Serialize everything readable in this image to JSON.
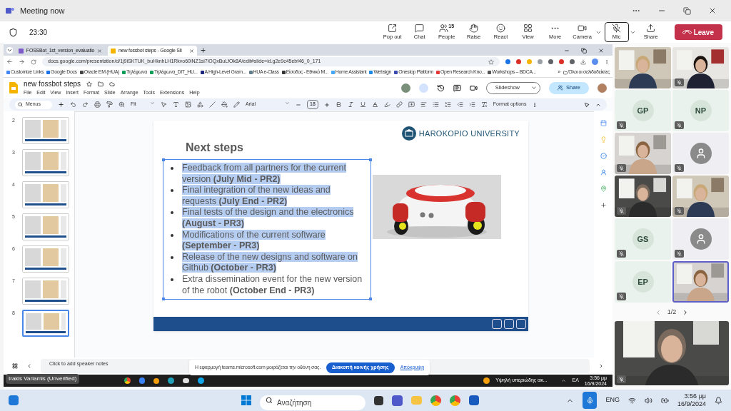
{
  "window": {
    "title": "Meeting now"
  },
  "meeting_bar": {
    "timer": "23:30",
    "actions": [
      {
        "kind": "popout",
        "label": "Pop out",
        "selected": false,
        "dropdown": false
      },
      {
        "kind": "chat",
        "label": "Chat",
        "selected": false,
        "dropdown": false
      },
      {
        "kind": "people",
        "label": "People",
        "count": "15",
        "selected": false,
        "dropdown": false
      },
      {
        "kind": "raise",
        "label": "Raise",
        "selected": false,
        "dropdown": false
      },
      {
        "kind": "react",
        "label": "React",
        "selected": false,
        "dropdown": false
      },
      {
        "kind": "view",
        "label": "View",
        "selected": false,
        "dropdown": false
      },
      {
        "kind": "more",
        "label": "More",
        "selected": false,
        "dropdown": false
      },
      {
        "kind": "camera",
        "label": "Camera",
        "selected": false,
        "dropdown": true
      },
      {
        "kind": "mic",
        "label": "Mic",
        "selected": true,
        "dropdown": true
      },
      {
        "kind": "share",
        "label": "Share",
        "selected": false,
        "dropdown": false
      }
    ],
    "leave_button": "Leave"
  },
  "shared_screen": {
    "browser": {
      "tabs": [
        {
          "title": "FOSSBot_1st_version_evaluatio",
          "selected": false
        },
        {
          "title": "new fossbot steps - Google Sli",
          "selected": true
        }
      ],
      "url": "docs.google.com/presentation/d/1j9iSKTUK_buHknhLH1Rkvo60lNZ1si7lOQxBuLfOk8A/edit#slide=id.g2e9c45ebf46_0_171",
      "bookmarks": [
        "Customize Links",
        "Google Docs",
        "Oracle EM (HUA)",
        "Τηλέφωνα",
        "Τηλέφωνα_DIT_HU...",
        "A High-Level Gram...",
        "HUA e-Class",
        "Είσοδος - Εθνικό Μ...",
        "Home Assistant",
        "Websign",
        "Onestop Platform",
        "Open Research Kno...",
        "Workshops – BDCA..."
      ],
      "more_bookmarks": "»",
      "all_bookmarks": "Όλοι οι σελιδοδείκτες"
    },
    "slides_app": {
      "doc_title": "new fossbot steps",
      "menu": [
        "File",
        "Edit",
        "View",
        "Insert",
        "Format",
        "Slide",
        "Arrange",
        "Tools",
        "Extensions",
        "Help"
      ],
      "slideshow_button": "Slideshow",
      "share_button": "Share",
      "toolbar": {
        "menus_search": "Menus",
        "zoom": "Fit",
        "font": "Arial",
        "font_size": "18",
        "format_options": "Format options"
      },
      "thumbnails": [
        {
          "number": "2",
          "selected": false
        },
        {
          "number": "3",
          "selected": false
        },
        {
          "number": "4",
          "selected": false
        },
        {
          "number": "5",
          "selected": false
        },
        {
          "number": "6",
          "selected": false
        },
        {
          "number": "7",
          "selected": false
        },
        {
          "number": "8",
          "selected": true
        }
      ],
      "slide": {
        "logo_text": "HAROKOPIO UNIVERSITY",
        "title": "Next steps",
        "bullets": [
          {
            "text": "Feedback from all partners for the current version **(July Mid - PR2)**",
            "highlighted": true
          },
          {
            "text": "Final integration of the new ideas and requests **(July End - PR2)**",
            "highlighted": true
          },
          {
            "text": "Final tests of the design and the electronics **(August - PR3)**",
            "highlighted": true
          },
          {
            "text": "Modifications of the current software **(September - PR3)**",
            "highlighted": true
          },
          {
            "text": "Release of the new designs and software on Github **(October - PR3)**",
            "highlighted": true
          },
          {
            "text": "Extra dissemination event for the new version of the robot **(October End - PR3)**",
            "highlighted": false
          }
        ]
      },
      "speaker_notes_placeholder": "Click to add speaker notes"
    },
    "share_banner": {
      "message": "Η εφαρμογή teams.microsoft.com μοιράζεται την οθόνη σας.",
      "stop_button": "Διακοπή κοινής χρήσης",
      "hide_link": "Απόκρυψη"
    },
    "taskbar": {
      "weather": "Υψηλή υπεριώδης ακ...",
      "language": "ΕΛ",
      "time": "3:56 μμ",
      "date": "16/9/2024"
    },
    "presenter_tooltip": "Irakis Varlamis (Unverified)"
  },
  "participants": {
    "tiles": [
      {
        "kind": "video",
        "muted": false,
        "speaking": false
      },
      {
        "kind": "video",
        "muted": true,
        "speaking": false
      },
      {
        "kind": "initials",
        "initials": "GP",
        "muted": true,
        "speaking": false
      },
      {
        "kind": "initials",
        "initials": "NP",
        "muted": true,
        "speaking": false
      },
      {
        "kind": "video",
        "muted": true,
        "speaking": false
      },
      {
        "kind": "avatar",
        "muted": true,
        "speaking": false
      },
      {
        "kind": "video",
        "muted": true,
        "speaking": false
      },
      {
        "kind": "video",
        "muted": true,
        "speaking": false
      },
      {
        "kind": "initials",
        "initials": "GS",
        "muted": true,
        "speaking": false
      },
      {
        "kind": "avatar",
        "muted": true,
        "speaking": false
      },
      {
        "kind": "initials",
        "initials": "EP",
        "muted": true,
        "speaking": false
      },
      {
        "kind": "video",
        "muted": false,
        "speaking": true
      }
    ],
    "page": "1/2",
    "self_view": {
      "muted": true
    }
  },
  "taskbar": {
    "search_placeholder": "Αναζήτηση",
    "language": "ENG",
    "time": "3:56 μμ",
    "date": "16/9/2024"
  }
}
